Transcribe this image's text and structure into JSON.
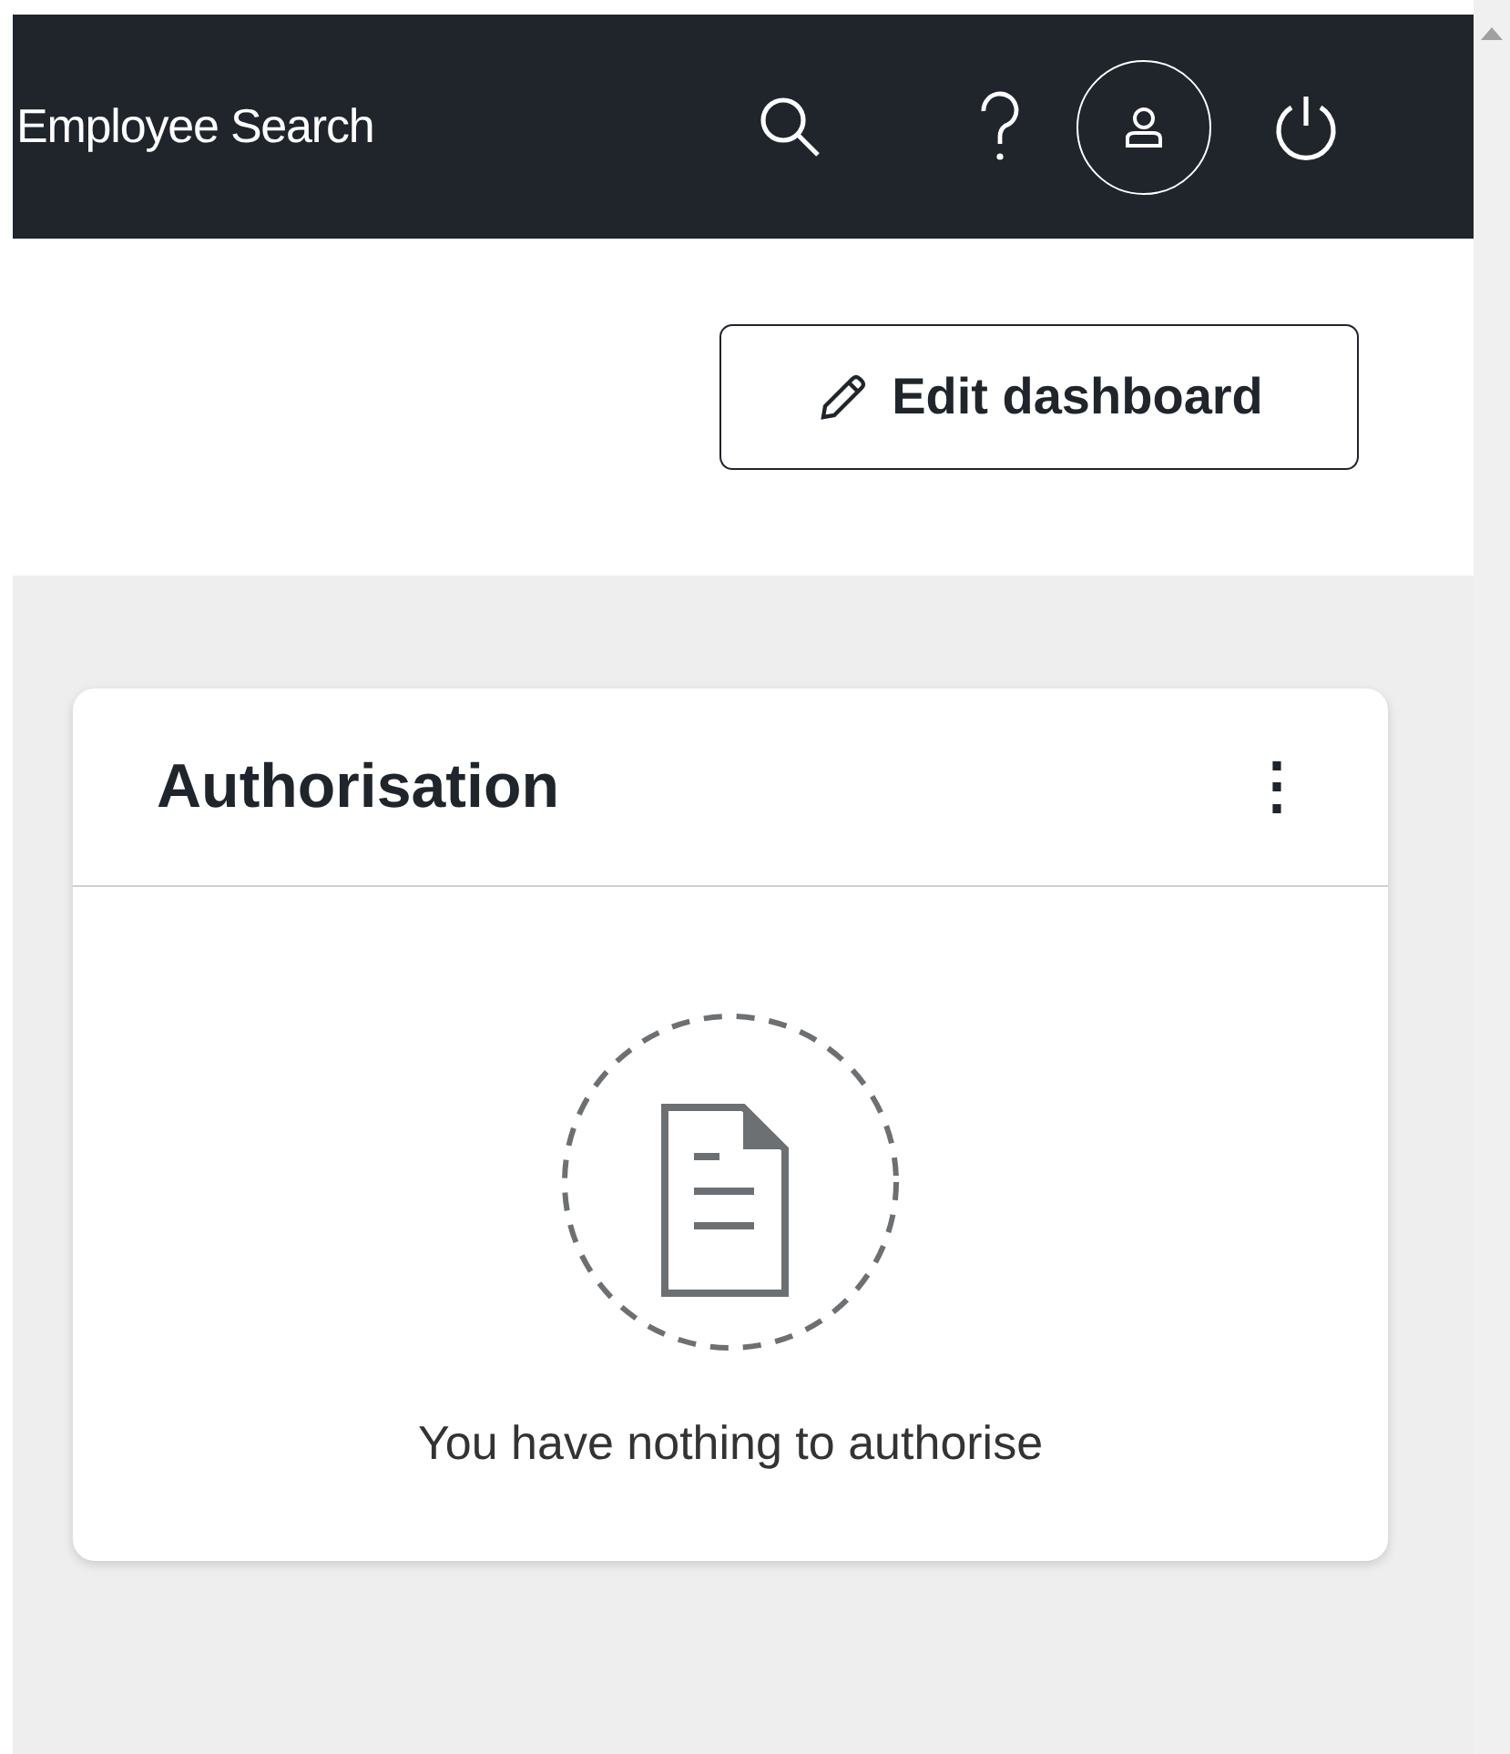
{
  "navbar": {
    "title": "Employee Search"
  },
  "toolbar": {
    "edit_button": "Edit dashboard"
  },
  "widget": {
    "title": "Authorisation",
    "menu_glyph": "⋮",
    "empty_message": "You have nothing to authorise"
  }
}
